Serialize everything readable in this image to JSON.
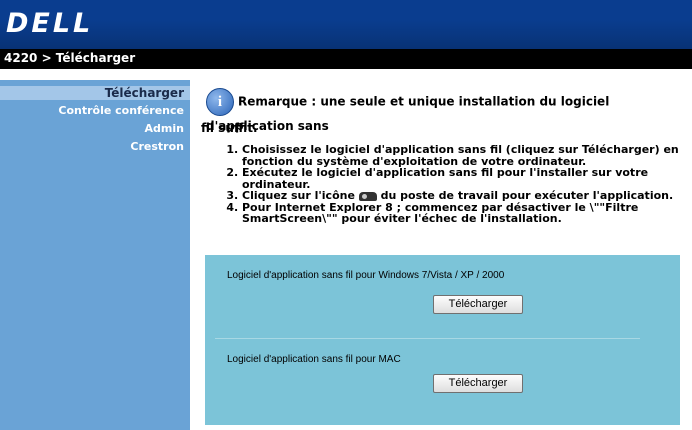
{
  "header": {
    "logo_text": "DELL",
    "brand_color": "#0a3d8f"
  },
  "breadcrumb": {
    "text": "4220 > Télécharger"
  },
  "sidebar": {
    "items": [
      {
        "label": "Télécharger",
        "active": true
      },
      {
        "label": "Contrôle conférence",
        "active": false
      },
      {
        "label": "Admin",
        "active": false
      },
      {
        "label": "Crestron",
        "active": false
      }
    ]
  },
  "main": {
    "remarque_part1": "Remarque : une seule et unique installation du logiciel d'application sans",
    "remarque_part2": "fil suffit.",
    "steps": {
      "s1": "Choisissez le logiciel d'application sans fil (cliquez sur Télécharger) en fonction du système d'exploitation de votre ordinateur.",
      "s2": "Exécutez le logiciel d'application sans fil pour l'installer sur votre ordinateur.",
      "s3_before": "Cliquez sur l'icône",
      "s3_after": "du poste de travail pour exécuter l'application.",
      "s4": "Pour Internet Explorer 8 ; commencez par désactiver le \\\"\"Filtre SmartScreen\\\"\" pour éviter l'échec de l'installation."
    }
  },
  "panel": {
    "color": "#7cc4d8",
    "windows_title": "Logiciel d'application sans fil pour Windows 7/Vista / XP / 2000",
    "windows_button": "Télécharger",
    "mac_title": "Logiciel d'application sans fil pour MAC",
    "mac_button": "Télécharger"
  },
  "icons": {
    "info": "info-icon",
    "projector": "projector-icon"
  }
}
